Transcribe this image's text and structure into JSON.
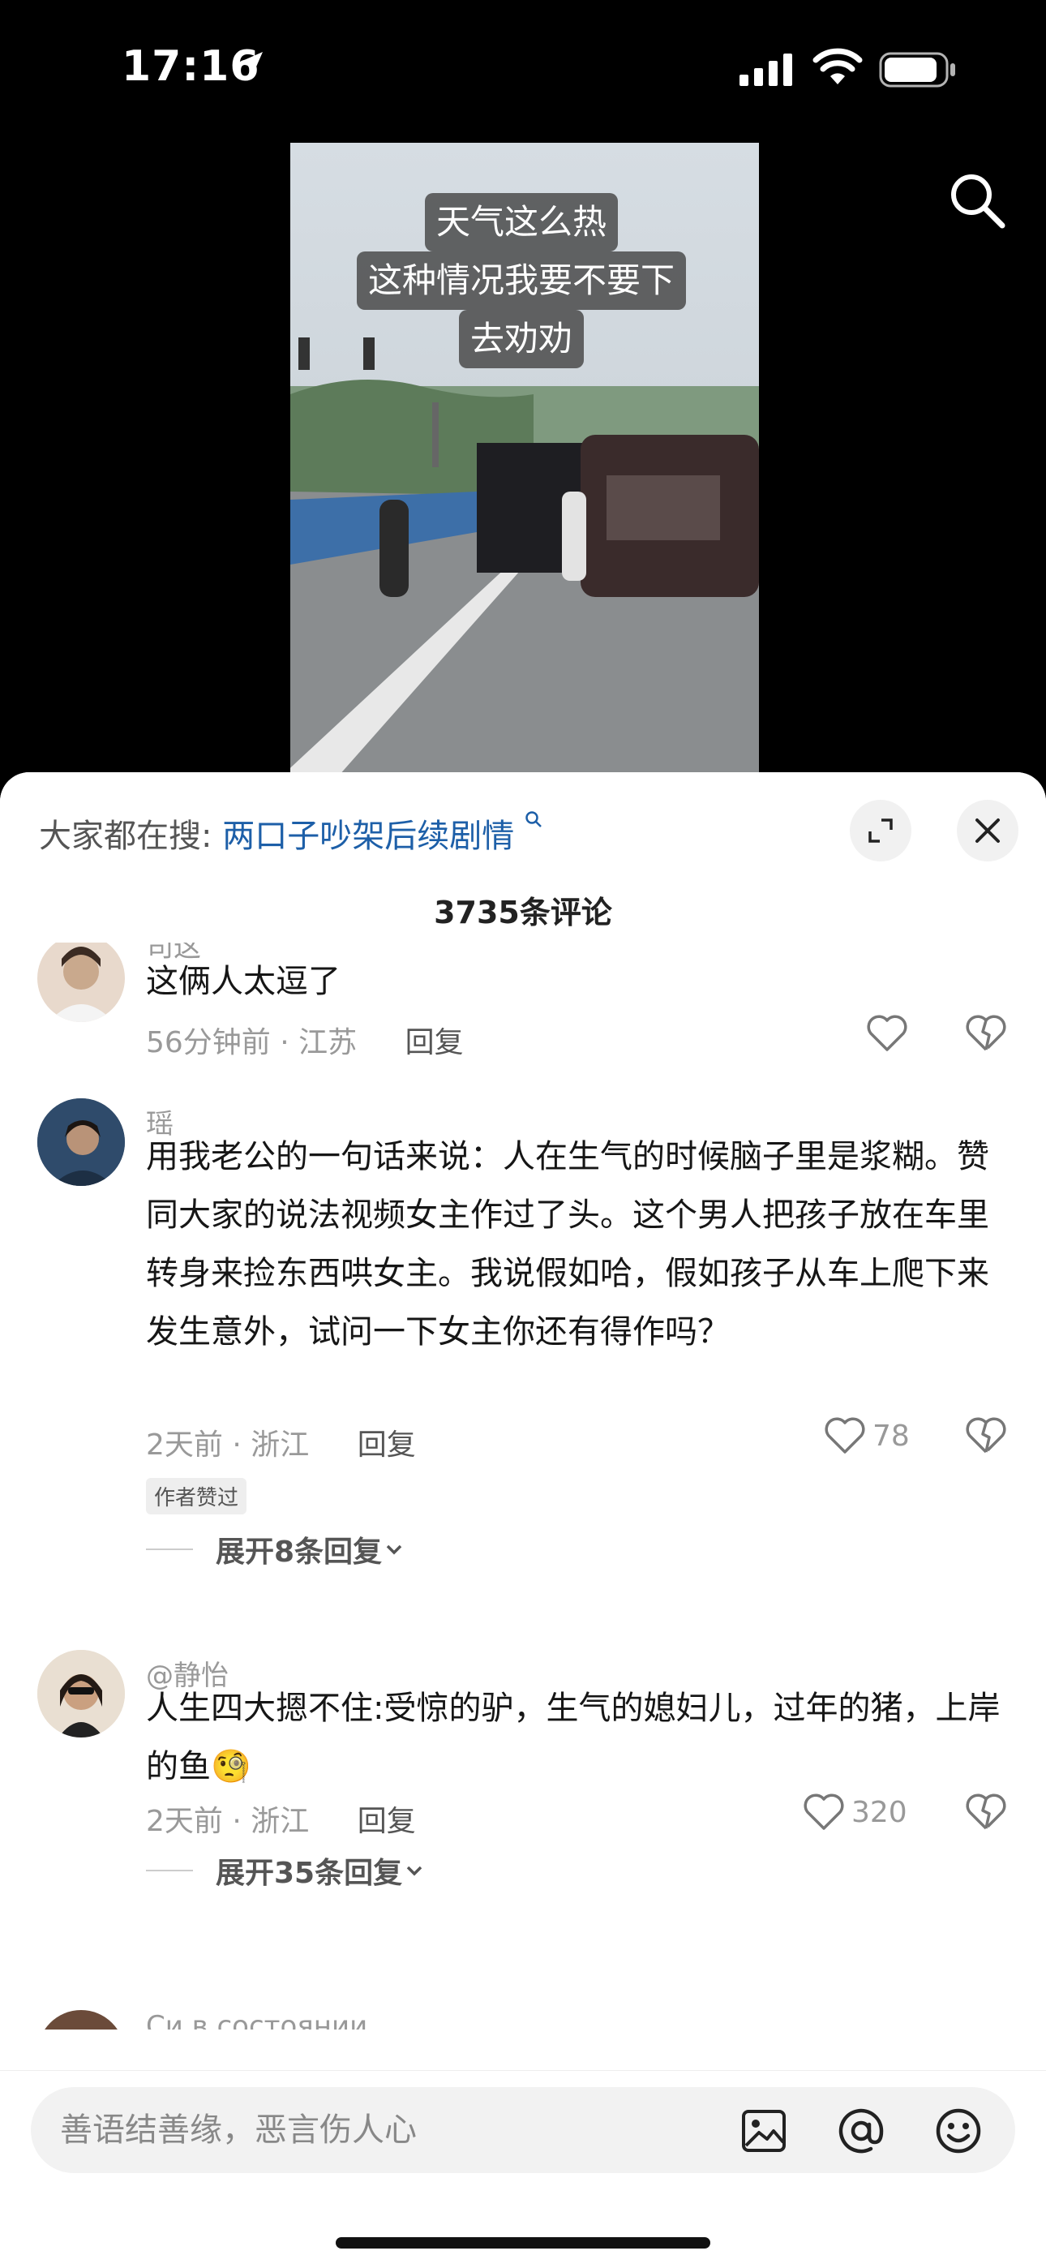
{
  "status_bar": {
    "time": "17:16"
  },
  "video": {
    "caption_lines": [
      "天气这么热",
      "这种情况我要不要下",
      "去劝劝"
    ]
  },
  "sheet": {
    "hot_search_label": "大家都在搜:",
    "hot_search_term": "两口子吵架后续剧情",
    "comment_count": "3735条评论"
  },
  "comments": [
    {
      "user": "司这",
      "text": "这俩人太逗了",
      "meta": "56分钟前 · 江苏",
      "reply_label": "回复",
      "likes": ""
    },
    {
      "user": "瑶",
      "text": "用我老公的一句话来说：人在生气的时候脑子里是浆糊。赞同大家的说法视频女主作过了头。这个男人把孩子放在车里转身来捡东西哄女主。我说假如哈，假如孩子从车上爬下来发生意外，试问一下女主你还有得作吗？",
      "meta": "2天前 · 浙江",
      "reply_label": "回复",
      "likes": "78",
      "badge": "作者赞过",
      "expand": "展开8条回复"
    },
    {
      "user": "@静怡",
      "text": "人生四大摁不住:受惊的驴，生气的媳妇儿，过年的猪，上岸的鱼🧐",
      "meta": "2天前 · 浙江",
      "reply_label": "回复",
      "likes": "320",
      "expand": "展开35条回复"
    },
    {
      "user": "Си в состоянии"
    }
  ],
  "input": {
    "placeholder": "善语结善缘，恶言伤人心"
  }
}
